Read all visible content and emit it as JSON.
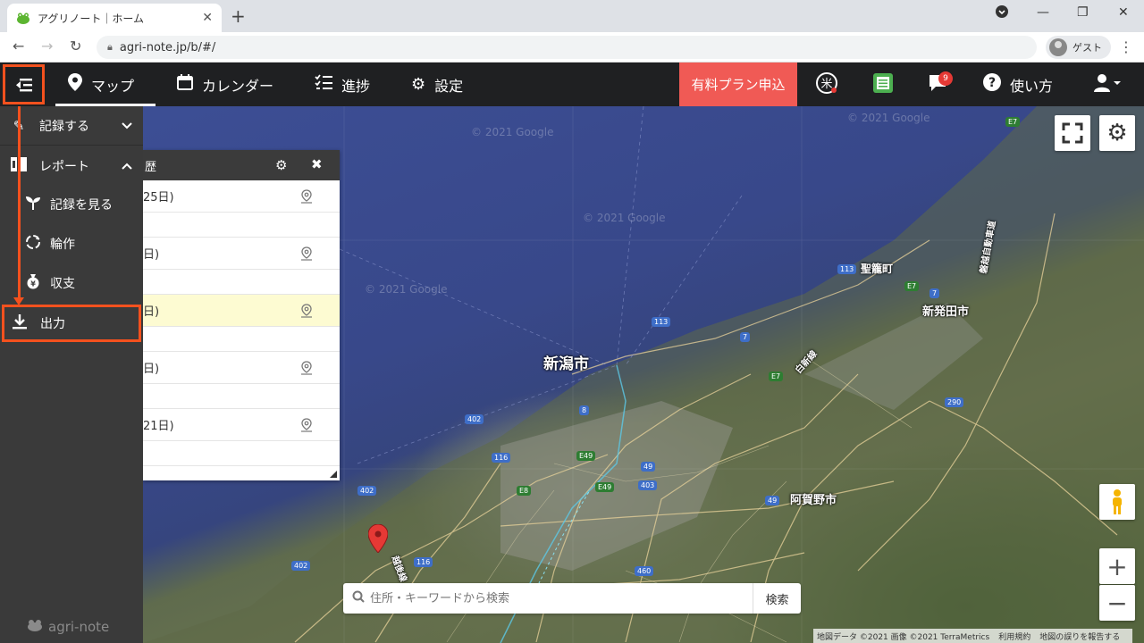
{
  "browser": {
    "tab_title": "アグリノート｜ホーム",
    "url": "agri-note.jp/b/#/",
    "profile_label": "ゲスト"
  },
  "nav": {
    "map": "マップ",
    "calendar": "カレンダー",
    "progress": "進捗",
    "settings": "設定",
    "paid_plan": "有料プラン申込",
    "help": "使い方",
    "notification_count": "9"
  },
  "sidebar": {
    "record": "記録する",
    "report": "レポート",
    "view_records": "記録を見る",
    "rotation": "輪作",
    "finance": "収支",
    "export": "出力",
    "brand": "agri-note"
  },
  "panel": {
    "title": "歴",
    "rows": [
      "25日)",
      "日)",
      "日)",
      "日)",
      "21日)"
    ]
  },
  "map": {
    "labels": {
      "niigata": "新潟市",
      "shibata": "新発田市",
      "seiro": "聖籠町",
      "agano": "阿賀野市",
      "shinshin": "白新線",
      "echigo": "越後線",
      "banetsu": "磐越自動車道"
    },
    "shields": [
      "E7",
      "113",
      "E7",
      "7",
      "113",
      "7",
      "E7",
      "8",
      "402",
      "116",
      "E49",
      "E49",
      "49",
      "403",
      "E8",
      "402",
      "116",
      "460",
      "290",
      "49",
      "402"
    ],
    "watermark": "© 2021 Google",
    "search_placeholder": "住所・キーワードから検索",
    "search_button": "検索",
    "attribution": [
      "地図データ ©2021 画像 ©2021 TerraMetrics",
      "利用規約",
      "地図の誤りを報告する"
    ]
  },
  "colors": {
    "accent_orange": "#f4511e",
    "paid_red": "#f05a55",
    "nav_dark": "#1f2022",
    "sidebar": "#3a3a3a"
  }
}
